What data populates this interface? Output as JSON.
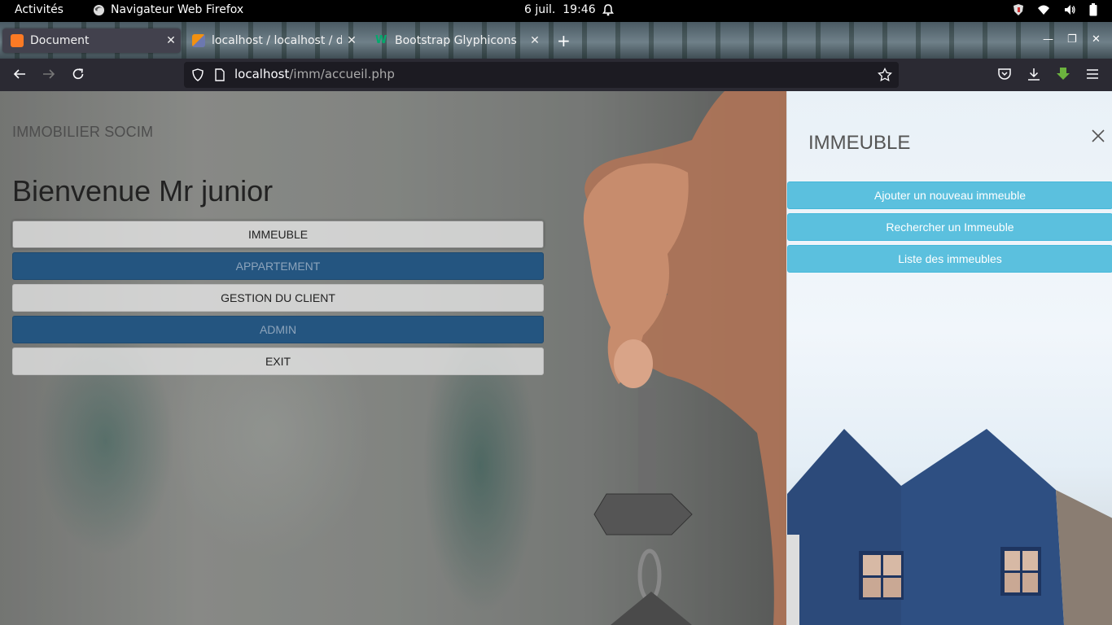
{
  "system": {
    "activities": "Activités",
    "app_name": "Navigateur Web Firefox",
    "date": "6 juil.",
    "time": "19:46"
  },
  "browser": {
    "tabs": [
      {
        "title": "Document",
        "active": true
      },
      {
        "title": "localhost / localhost / db",
        "active": false
      },
      {
        "title": "Bootstrap Glyphicons",
        "active": false
      }
    ],
    "url_host": "localhost",
    "url_path": "/imm/accueil.php"
  },
  "page": {
    "brand": "IMMOBILIER SOCIM",
    "welcome": "Bienvenue Mr junior",
    "menu": [
      {
        "label": "IMMEUBLE",
        "style": "light"
      },
      {
        "label": "APPARTEMENT",
        "style": "dark"
      },
      {
        "label": "GESTION DU CLIENT",
        "style": "light"
      },
      {
        "label": "ADMIN",
        "style": "dark"
      },
      {
        "label": "EXIT",
        "style": "light"
      }
    ]
  },
  "panel": {
    "title": "IMMEUBLE",
    "actions": [
      "Ajouter un nouveau immeuble",
      "Rechercher un Immeuble",
      "Liste des immeubles"
    ]
  },
  "colors": {
    "primary_dark": "#245580",
    "info": "#5bc0de",
    "chrome": "#2b2a33"
  }
}
